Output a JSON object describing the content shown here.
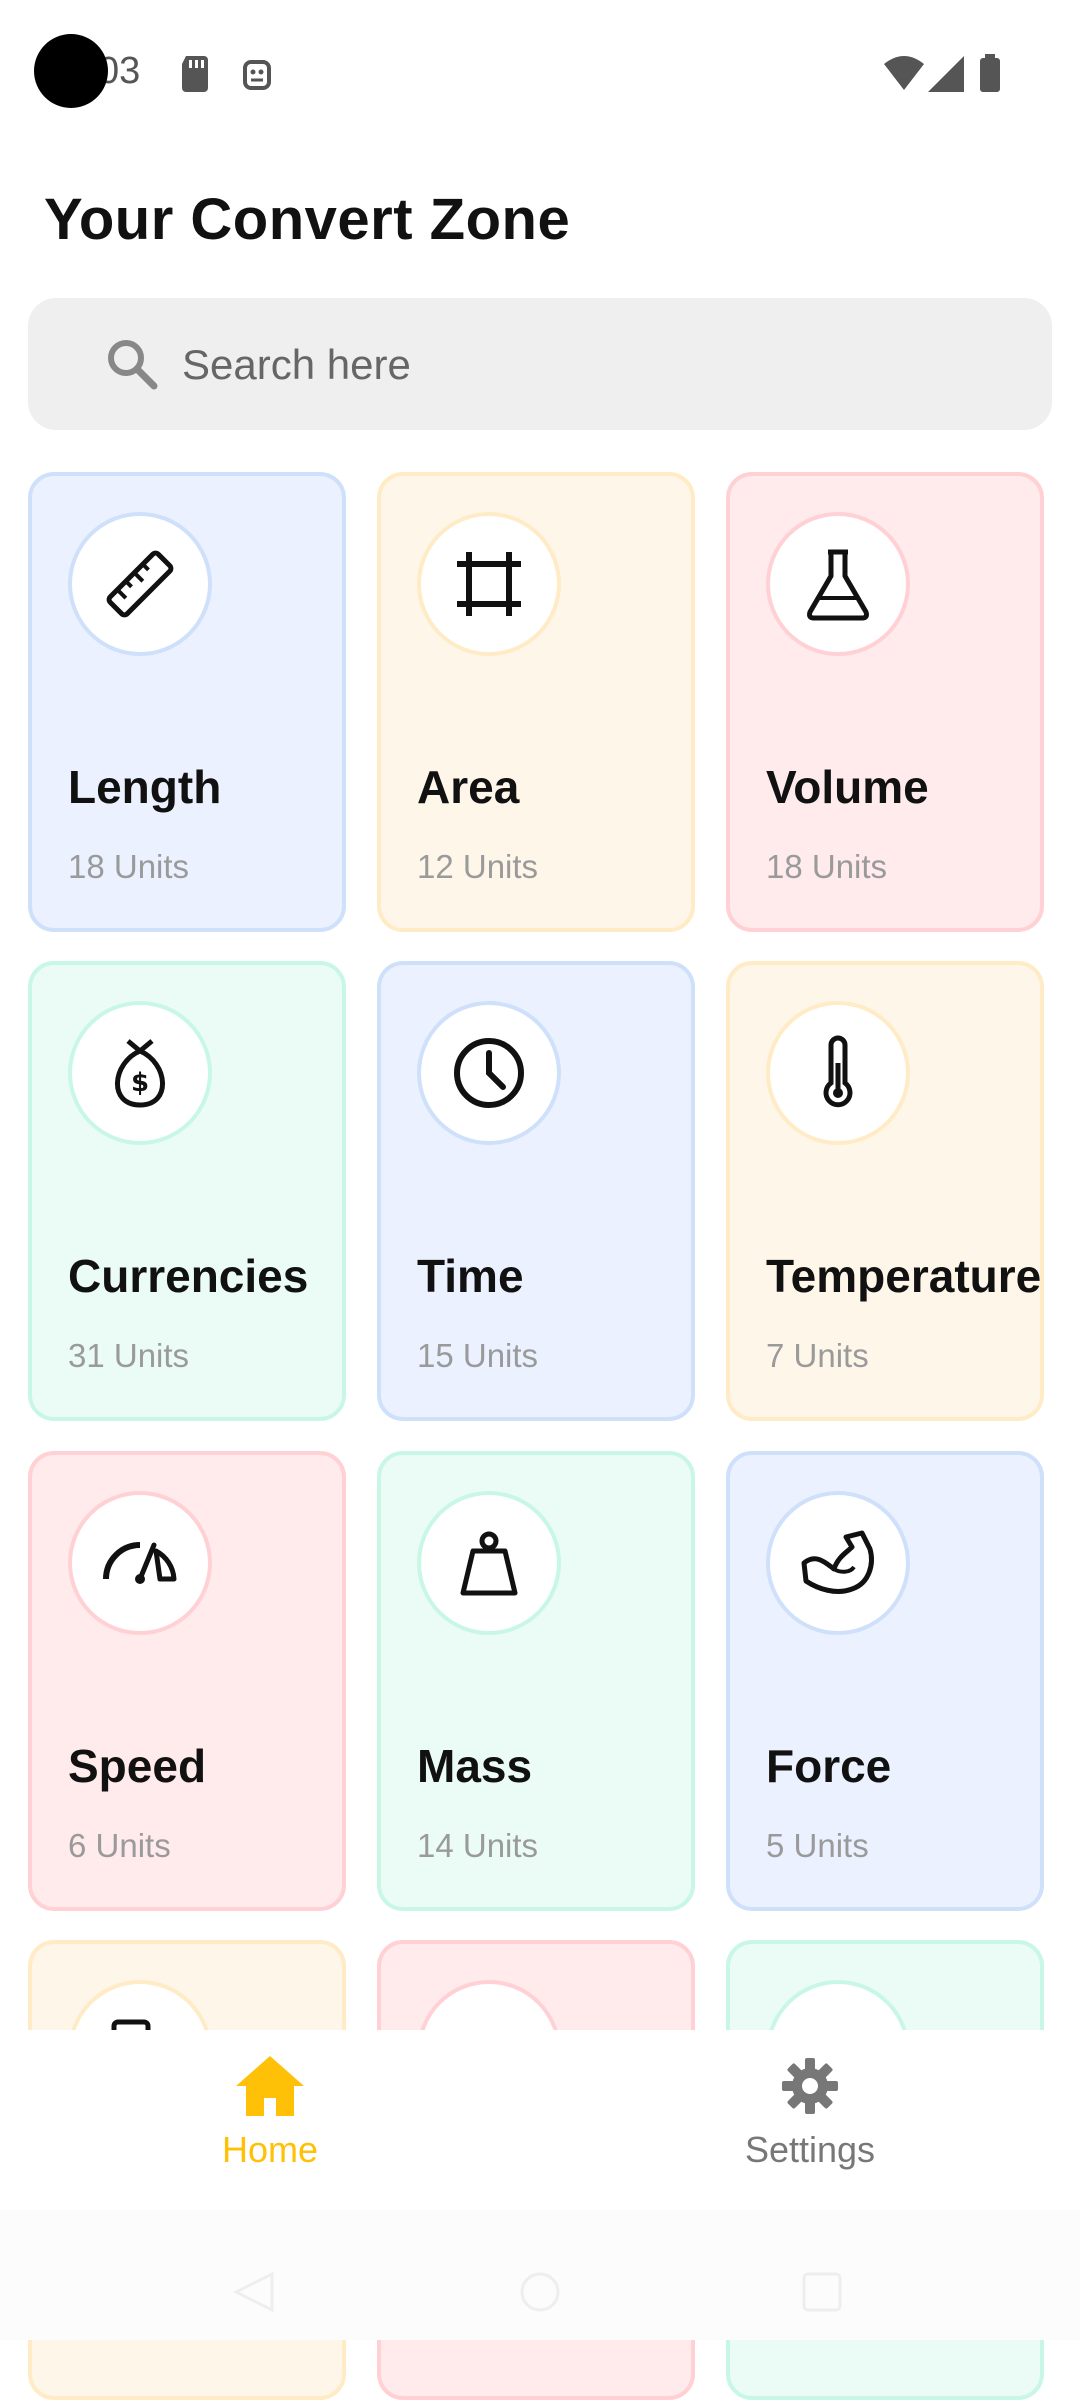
{
  "status_bar": {
    "time": "03"
  },
  "header": {
    "title": "Your Convert Zone"
  },
  "search": {
    "placeholder": "Search here",
    "value": ""
  },
  "categories": [
    {
      "name": "Length",
      "units": "18 Units",
      "icon": "ruler-icon",
      "color": "#ebf1ff"
    },
    {
      "name": "Area",
      "units": "12 Units",
      "icon": "crop-icon",
      "color": "#fff6ea"
    },
    {
      "name": "Volume",
      "units": "18 Units",
      "icon": "flask-icon",
      "color": "#ffeaec"
    },
    {
      "name": "Currencies",
      "units": "31 Units",
      "icon": "money-bag-icon",
      "color": "#eafcf5"
    },
    {
      "name": "Time",
      "units": "15 Units",
      "icon": "clock-icon",
      "color": "#ebf1ff"
    },
    {
      "name": "Temperature",
      "units": "7 Units",
      "icon": "thermometer-icon",
      "color": "#fff6ea"
    },
    {
      "name": "Speed",
      "units": "6 Units",
      "icon": "speedometer-icon",
      "color": "#ffeaec"
    },
    {
      "name": "Mass",
      "units": "14 Units",
      "icon": "weight-icon",
      "color": "#eafcf5"
    },
    {
      "name": "Force",
      "units": "5 Units",
      "icon": "muscle-icon",
      "color": "#ebf1ff"
    }
  ],
  "bottom_nav": {
    "items": [
      {
        "label": "Home",
        "icon": "home-icon",
        "active": true,
        "color": "#ffc107"
      },
      {
        "label": "Settings",
        "icon": "gear-icon",
        "active": false,
        "color": "#777777"
      }
    ]
  }
}
